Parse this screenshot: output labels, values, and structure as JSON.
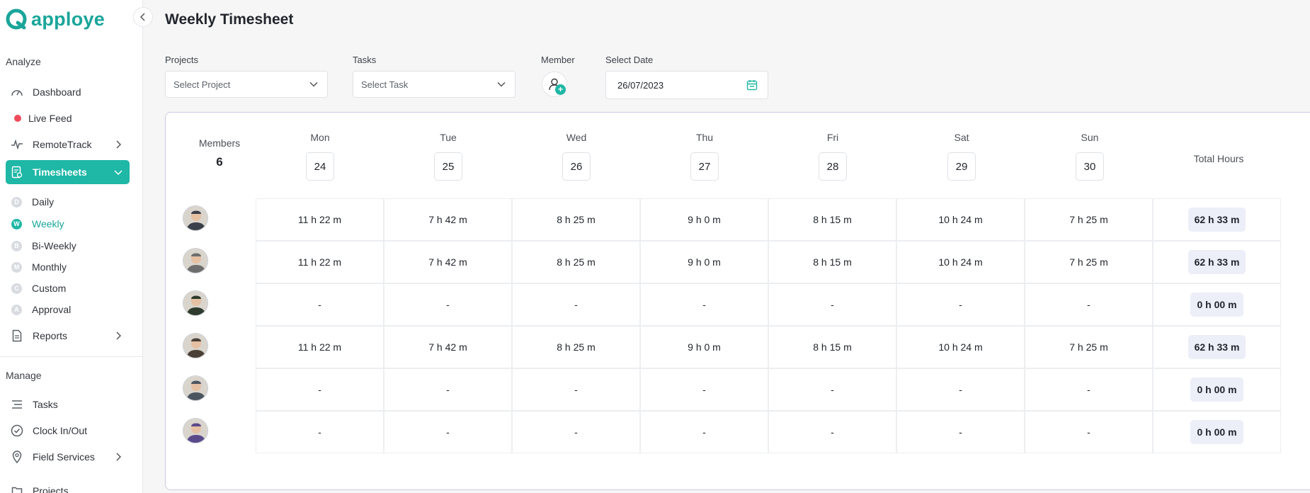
{
  "app": {
    "brand": "apploye",
    "collapse_icon": "chevron-left-icon"
  },
  "sidebar": {
    "analyze_title": "Analyze",
    "manage_title": "Manage",
    "items": [
      {
        "label": "Dashboard",
        "icon": "gauge-icon"
      },
      {
        "label": "Live Feed",
        "icon": "live-dot-icon"
      },
      {
        "label": "RemoteTrack",
        "icon": "pulse-icon",
        "has_submenu": true
      },
      {
        "label": "Timesheets",
        "icon": "timesheet-icon",
        "active": true,
        "expanded": true
      },
      {
        "label": "Reports",
        "icon": "report-icon",
        "has_submenu": true
      },
      {
        "label": "Tasks",
        "icon": "tasks-icon"
      },
      {
        "label": "Clock In/Out",
        "icon": "clock-icon"
      },
      {
        "label": "Field Services",
        "icon": "location-pin-icon",
        "has_submenu": true
      },
      {
        "label": "Projects",
        "icon": "folder-icon"
      }
    ],
    "timesheet_sub": [
      {
        "badge": "D",
        "label": "Daily"
      },
      {
        "badge": "W",
        "label": "Weekly",
        "active": true
      },
      {
        "badge": "B",
        "label": "Bi-Weekly"
      },
      {
        "badge": "M",
        "label": "Monthly"
      },
      {
        "badge": "C",
        "label": "Custom"
      },
      {
        "badge": "A",
        "label": "Approval"
      }
    ]
  },
  "page": {
    "title": "Weekly Timesheet"
  },
  "filters": {
    "projects_label": "Projects",
    "projects_placeholder": "Select Project",
    "tasks_label": "Tasks",
    "tasks_placeholder": "Select Task",
    "member_label": "Member",
    "date_label": "Select Date",
    "date_value": "26/07/2023"
  },
  "grid": {
    "members_label": "Members",
    "members_count": "6",
    "total_label": "Total Hours",
    "days": [
      {
        "name": "Mon",
        "date": "24"
      },
      {
        "name": "Tue",
        "date": "25"
      },
      {
        "name": "Wed",
        "date": "26"
      },
      {
        "name": "Thu",
        "date": "27"
      },
      {
        "name": "Fri",
        "date": "28"
      },
      {
        "name": "Sat",
        "date": "29"
      },
      {
        "name": "Sun",
        "date": "30"
      }
    ],
    "rows": [
      {
        "avatar_color": "#3a3f4a",
        "hours": [
          "11 h 22 m",
          "7 h 42 m",
          "8 h 25 m",
          "9 h 0 m",
          "8 h 15 m",
          "10 h 24 m",
          "7 h 25 m"
        ],
        "total": "62 h 33 m"
      },
      {
        "avatar_color": "#6d6d6d",
        "hours": [
          "11 h 22 m",
          "7 h 42 m",
          "8 h 25 m",
          "9 h 0 m",
          "8 h 15 m",
          "10 h 24 m",
          "7 h 25 m"
        ],
        "total": "62 h 33 m"
      },
      {
        "avatar_color": "#2e3b2e",
        "hours": [
          "-",
          "-",
          "-",
          "-",
          "-",
          "-",
          "-"
        ],
        "total": "0 h 00 m"
      },
      {
        "avatar_color": "#4a4036",
        "hours": [
          "11 h 22 m",
          "7 h 42 m",
          "8 h 25 m",
          "9 h 0 m",
          "8 h 15 m",
          "10 h 24 m",
          "7 h 25 m"
        ],
        "total": "62 h 33 m"
      },
      {
        "avatar_color": "#4b5560",
        "hours": [
          "-",
          "-",
          "-",
          "-",
          "-",
          "-",
          "-"
        ],
        "total": "0 h 00 m"
      },
      {
        "avatar_color": "#5a4a8a",
        "hours": [
          "-",
          "-",
          "-",
          "-",
          "-",
          "-",
          "-"
        ],
        "total": "0 h 00 m"
      }
    ]
  },
  "colors": {
    "accent": "#1fb7a6",
    "brand": "#1aa59a",
    "live": "#f04b5a",
    "total_pill": "#eceef8"
  }
}
